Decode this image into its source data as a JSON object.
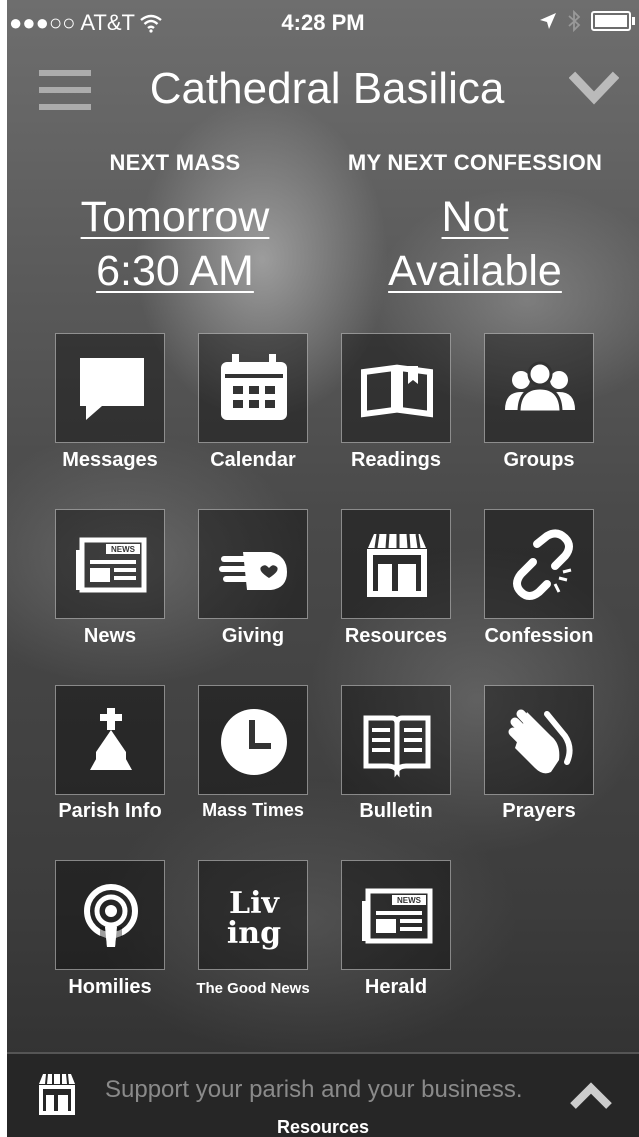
{
  "status_bar": {
    "carrier": "●●●○○ AT&T",
    "time": "4:28 PM"
  },
  "header": {
    "title": "Cathedral Basilica"
  },
  "next_mass": {
    "label": "NEXT MASS",
    "line1": "Tomorrow",
    "line2": "6:30 AM"
  },
  "next_confession": {
    "label": "MY NEXT CONFESSION",
    "line1": "Not",
    "line2": "Available"
  },
  "tiles": [
    {
      "label": "Messages",
      "icon": "chat-bubble-icon"
    },
    {
      "label": "Calendar",
      "icon": "calendar-icon"
    },
    {
      "label": "Readings",
      "icon": "open-book-icon"
    },
    {
      "label": "Groups",
      "icon": "people-icon"
    },
    {
      "label": "News",
      "icon": "newspaper-icon"
    },
    {
      "label": "Giving",
      "icon": "hand-heart-icon"
    },
    {
      "label": "Resources",
      "icon": "storefront-icon"
    },
    {
      "label": "Confession",
      "icon": "broken-chain-icon"
    },
    {
      "label": "Parish Info",
      "icon": "church-icon"
    },
    {
      "label": "Mass Times",
      "icon": "clock-icon"
    },
    {
      "label": "Bulletin",
      "icon": "book-pages-icon"
    },
    {
      "label": "Prayers",
      "icon": "praying-hands-icon"
    },
    {
      "label": "Homilies",
      "icon": "podcast-icon"
    },
    {
      "label": "The Good News",
      "icon": "living-logo-icon",
      "logo_text_1": "Liv",
      "logo_text_2": "ing"
    },
    {
      "label": "Herald",
      "icon": "newspaper-icon"
    }
  ],
  "newspaper_badge": "NEWS",
  "footer": {
    "promo": "Support your parish and your business.",
    "caption": "Resources"
  },
  "colors": {
    "text": "#ffffff",
    "footer_bg": "#262626",
    "promo_text": "#8a8a8a"
  }
}
